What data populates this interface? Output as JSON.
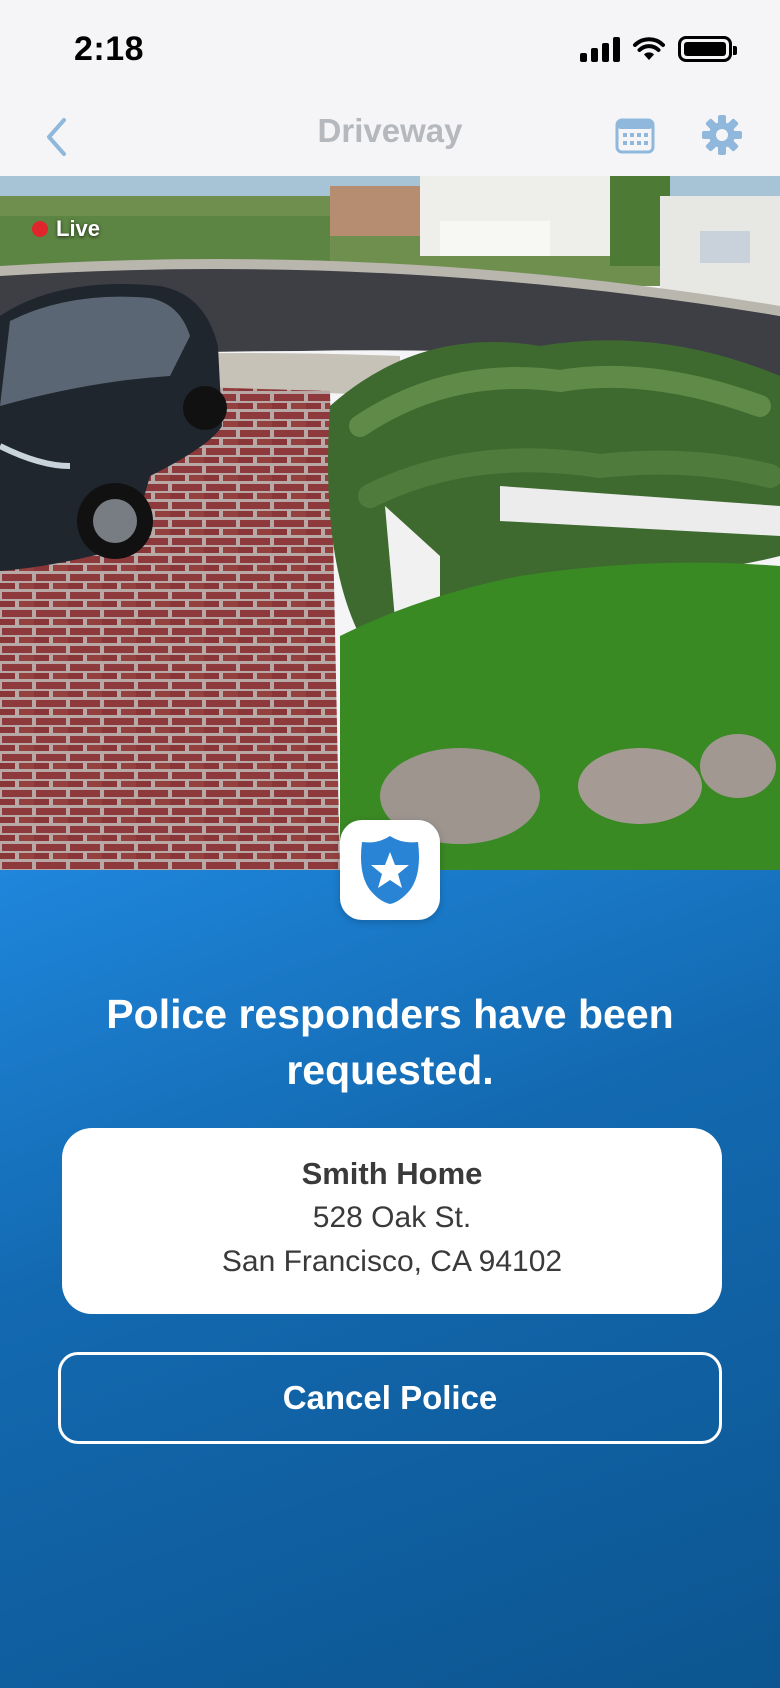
{
  "status_bar": {
    "time": "2:18"
  },
  "nav": {
    "title": "Driveway"
  },
  "camera": {
    "live_label": "Live"
  },
  "alert": {
    "title": "Police responders have been requested.",
    "address": {
      "name": "Smith Home",
      "street": "528 Oak St.",
      "city_line": "San Francisco, CA 94102"
    },
    "cancel_label": "Cancel Police"
  },
  "colors": {
    "accent": "#1f86db",
    "live": "#e0262c",
    "nav_icon": "#8fb8dc"
  },
  "icons": [
    "back-chevron-icon",
    "calendar-icon",
    "gear-icon",
    "police-badge-icon",
    "signal-icon",
    "wifi-icon",
    "battery-icon"
  ]
}
